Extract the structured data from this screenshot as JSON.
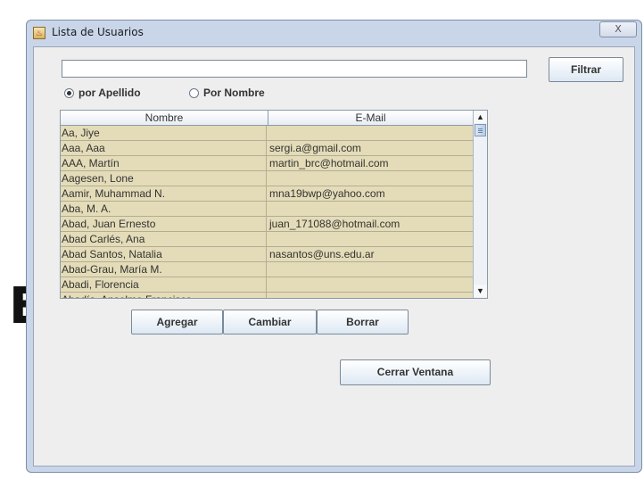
{
  "background_fragment": "E",
  "window": {
    "title": "Lista de Usuarios",
    "close_symbol": "X"
  },
  "filter": {
    "input_value": "",
    "button_label": "Filtrar"
  },
  "radios": [
    {
      "label": "por Apellido",
      "checked": true
    },
    {
      "label": "Por Nombre",
      "checked": false
    }
  ],
  "table": {
    "columns": [
      "Nombre",
      "E-Mail"
    ],
    "rows": [
      {
        "nombre": "Aa, Jiye",
        "email": ""
      },
      {
        "nombre": "Aaa, Aaa",
        "email": "sergi.a@gmail.com"
      },
      {
        "nombre": "AAA, Martín",
        "email": "martin_brc@hotmail.com"
      },
      {
        "nombre": "Aagesen, Lone",
        "email": ""
      },
      {
        "nombre": "Aamir, Muhammad N.",
        "email": "mna19bwp@yahoo.com"
      },
      {
        "nombre": "Aba, M. A.",
        "email": ""
      },
      {
        "nombre": "Abad, Juan Ernesto",
        "email": "juan_171088@hotmail.com"
      },
      {
        "nombre": "Abad Carlés, Ana",
        "email": ""
      },
      {
        "nombre": "Abad Santos, Natalia",
        "email": "nasantos@uns.edu.ar"
      },
      {
        "nombre": "Abad-Grau, María M.",
        "email": ""
      },
      {
        "nombre": "Abadi, Florencia",
        "email": ""
      },
      {
        "nombre": "Abadía, Anselmo Francisco",
        "email": ""
      }
    ]
  },
  "actions": {
    "add_label": "Agregar",
    "change_label": "Cambiar",
    "delete_label": "Borrar",
    "close_window_label": "Cerrar Ventana"
  },
  "colors": {
    "row_background": "#e4dcb8",
    "window_frame": "#c9d6ea",
    "client_background": "#eeeeee"
  },
  "icons": {
    "app": "java-cup-icon",
    "close": "close-icon"
  }
}
